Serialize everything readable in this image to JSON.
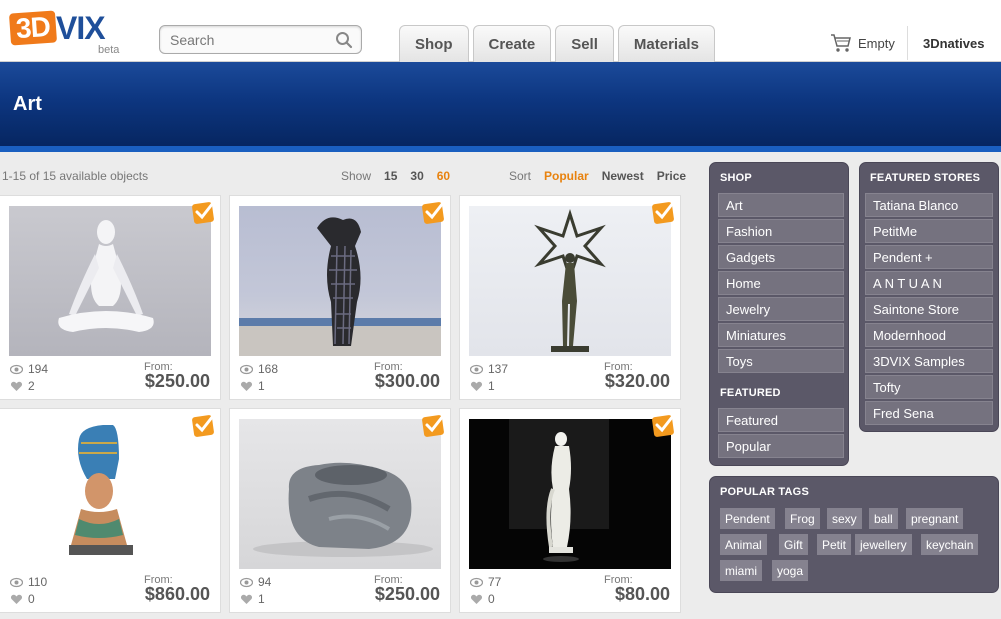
{
  "header": {
    "logo_3d": "3D",
    "logo_vix": "VIX",
    "logo_beta": "beta",
    "search_placeholder": "Search",
    "nav": [
      "Shop",
      "Create",
      "Sell",
      "Materials"
    ],
    "cart_label": "Empty",
    "account_label": "3Dnatives"
  },
  "banner": {
    "title": "Art"
  },
  "toolbar": {
    "results": "1-15 of 15 available objects",
    "show_label": "Show",
    "show_options": [
      "15",
      "30",
      "60"
    ],
    "show_active": "60",
    "sort_label": "Sort",
    "sort_options": [
      "Popular",
      "Newest",
      "Price"
    ],
    "sort_active": "Popular"
  },
  "products": [
    {
      "views": "194",
      "likes": "2",
      "from_label": "From:",
      "price": "$250.00",
      "image": "meditating-figure"
    },
    {
      "views": "168",
      "likes": "1",
      "from_label": "From:",
      "price": "$300.00",
      "image": "lattice-torso"
    },
    {
      "views": "137",
      "likes": "1",
      "from_label": "From:",
      "price": "$320.00",
      "image": "star-figure"
    },
    {
      "views": "110",
      "likes": "0",
      "from_label": "From:",
      "price": "$860.00",
      "image": "nefertiti-bust"
    },
    {
      "views": "94",
      "likes": "1",
      "from_label": "From:",
      "price": "$250.00",
      "image": "gray-sculpture"
    },
    {
      "views": "77",
      "likes": "0",
      "from_label": "From:",
      "price": "$80.00",
      "image": "venus-statue"
    }
  ],
  "sidebar": {
    "shop_title": "SHOP",
    "shop_items": [
      "Art",
      "Fashion",
      "Gadgets",
      "Home",
      "Jewelry",
      "Miniatures",
      "Toys"
    ],
    "featured_title": "FEATURED",
    "featured_items": [
      "Featured",
      "Popular"
    ],
    "stores_title": "FEATURED STORES",
    "stores": [
      "Tatiana Blanco",
      "PetitMe",
      "Pendent +",
      "A N T U A N",
      "Saintone Store",
      "Modernhood",
      "3DVIX Samples",
      "Tofty",
      "Fred Sena"
    ],
    "tags_title": "POPULAR TAGS",
    "tags": [
      "Pendent",
      "Frog",
      "sexy",
      "ball",
      "pregnant",
      "Animal",
      "Gift",
      "Petit",
      "jewellery",
      "keychain",
      "miami",
      "yoga"
    ]
  },
  "colors": {
    "accent": "#e8820e",
    "banner": "#0d3680",
    "sidebar": "#5b5868"
  }
}
